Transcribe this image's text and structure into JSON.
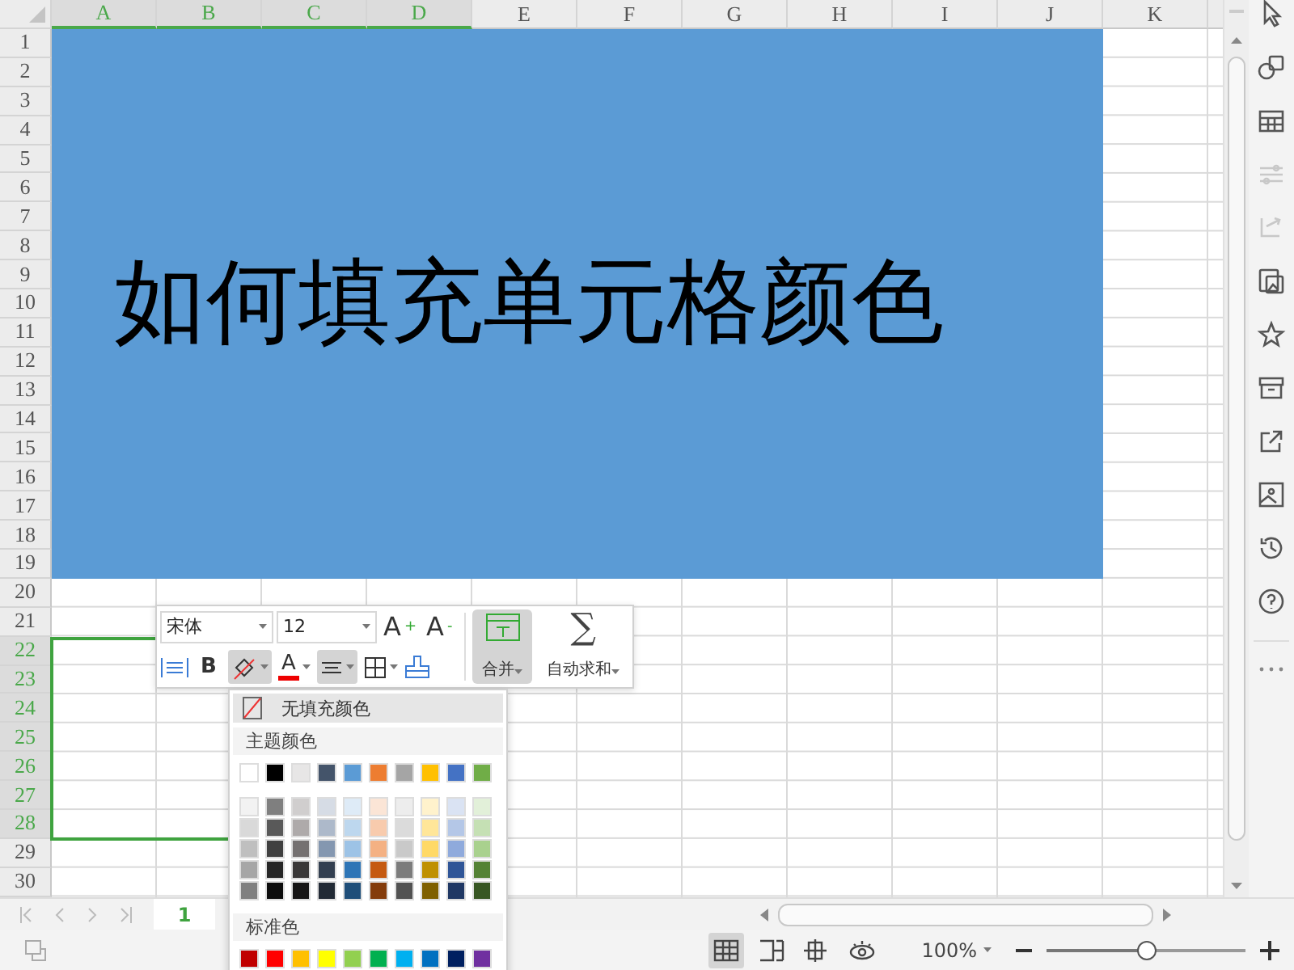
{
  "columns": [
    {
      "label": "A",
      "selected": true
    },
    {
      "label": "B",
      "selected": true
    },
    {
      "label": "C",
      "selected": true
    },
    {
      "label": "D",
      "selected": true
    },
    {
      "label": "E",
      "selected": false
    },
    {
      "label": "F",
      "selected": false
    },
    {
      "label": "G",
      "selected": false
    },
    {
      "label": "H",
      "selected": false
    },
    {
      "label": "I",
      "selected": false
    },
    {
      "label": "J",
      "selected": false
    },
    {
      "label": "K",
      "selected": false
    }
  ],
  "rows": [
    {
      "label": "1",
      "selected": false
    },
    {
      "label": "2",
      "selected": false
    },
    {
      "label": "3",
      "selected": false
    },
    {
      "label": "4",
      "selected": false
    },
    {
      "label": "5",
      "selected": false
    },
    {
      "label": "6",
      "selected": false
    },
    {
      "label": "7",
      "selected": false
    },
    {
      "label": "8",
      "selected": false
    },
    {
      "label": "9",
      "selected": false
    },
    {
      "label": "10",
      "selected": false
    },
    {
      "label": "11",
      "selected": false
    },
    {
      "label": "12",
      "selected": false
    },
    {
      "label": "13",
      "selected": false
    },
    {
      "label": "14",
      "selected": false
    },
    {
      "label": "15",
      "selected": false
    },
    {
      "label": "16",
      "selected": false
    },
    {
      "label": "17",
      "selected": false
    },
    {
      "label": "18",
      "selected": false
    },
    {
      "label": "19",
      "selected": false
    },
    {
      "label": "20",
      "selected": false
    },
    {
      "label": "21",
      "selected": false
    },
    {
      "label": "22",
      "selected": true
    },
    {
      "label": "23",
      "selected": true
    },
    {
      "label": "24",
      "selected": true
    },
    {
      "label": "25",
      "selected": true
    },
    {
      "label": "26",
      "selected": true
    },
    {
      "label": "27",
      "selected": true
    },
    {
      "label": "28",
      "selected": true
    },
    {
      "label": "29",
      "selected": false
    },
    {
      "label": "30",
      "selected": false
    }
  ],
  "merged_cell": {
    "text": "如何填充单元格颜色"
  },
  "mini_toolbar": {
    "font_name": "宋体",
    "font_size": "12",
    "grow_font_label": "A",
    "grow_font_sign": "+",
    "shrink_font_label": "A",
    "shrink_font_sign": "-",
    "bold_label": "B",
    "font_color_label": "A",
    "fill_pressed": true,
    "align_pressed": true,
    "merge_label": "合并",
    "merge_pressed": true,
    "autosum_symbol": "∑",
    "autosum_label": "自动求和"
  },
  "fill_menu": {
    "no_fill_label": "无填充颜色",
    "theme_label": "主题颜色",
    "theme_colors": [
      {
        "color": "#ffffff"
      },
      {
        "color": "#000000"
      },
      {
        "color": "#e7e6e6"
      },
      {
        "color": "#44546a"
      },
      {
        "color": "#5b9bd5"
      },
      {
        "color": "#ed7d31"
      },
      {
        "color": "#a5a5a5"
      },
      {
        "color": "#ffc000"
      },
      {
        "color": "#4472c4"
      },
      {
        "color": "#70ad47"
      }
    ],
    "shade_rows": [
      {
        "colors": [
          {
            "color": "#f2f2f2"
          },
          {
            "color": "#7f7f7f"
          },
          {
            "color": "#d0cece"
          },
          {
            "color": "#d6dce5"
          },
          {
            "color": "#deebf7"
          },
          {
            "color": "#fbe5d6"
          },
          {
            "color": "#ededed"
          },
          {
            "color": "#fff2cc"
          },
          {
            "color": "#dae3f3"
          },
          {
            "color": "#e2f0d9"
          }
        ]
      },
      {
        "colors": [
          {
            "color": "#d9d9d9"
          },
          {
            "color": "#595959"
          },
          {
            "color": "#aeaaaa"
          },
          {
            "color": "#adb9ca"
          },
          {
            "color": "#bdd7ee"
          },
          {
            "color": "#f8cbad"
          },
          {
            "color": "#dbdbdb"
          },
          {
            "color": "#ffe699"
          },
          {
            "color": "#b4c7e7"
          },
          {
            "color": "#c5e0b4"
          }
        ]
      },
      {
        "colors": [
          {
            "color": "#bfbfbf"
          },
          {
            "color": "#404040"
          },
          {
            "color": "#757171"
          },
          {
            "color": "#8497b0"
          },
          {
            "color": "#9dc3e6"
          },
          {
            "color": "#f4b183"
          },
          {
            "color": "#c9c9c9"
          },
          {
            "color": "#ffd966"
          },
          {
            "color": "#8faadc"
          },
          {
            "color": "#a9d18e"
          }
        ]
      },
      {
        "colors": [
          {
            "color": "#a6a6a6"
          },
          {
            "color": "#262626"
          },
          {
            "color": "#3a3838"
          },
          {
            "color": "#333f50"
          },
          {
            "color": "#2e75b6"
          },
          {
            "color": "#c55a11"
          },
          {
            "color": "#7c7c7c"
          },
          {
            "color": "#bf9000"
          },
          {
            "color": "#2f5597"
          },
          {
            "color": "#548235"
          }
        ]
      },
      {
        "colors": [
          {
            "color": "#808080"
          },
          {
            "color": "#0d0d0d"
          },
          {
            "color": "#171616"
          },
          {
            "color": "#222a35"
          },
          {
            "color": "#1f4e79"
          },
          {
            "color": "#843c0c"
          },
          {
            "color": "#525252"
          },
          {
            "color": "#7f6000"
          },
          {
            "color": "#203864"
          },
          {
            "color": "#385723"
          }
        ]
      }
    ],
    "standard_label": "标准色",
    "standard_colors": [
      {
        "color": "#c00000"
      },
      {
        "color": "#ff0000"
      },
      {
        "color": "#ffc000"
      },
      {
        "color": "#ffff00"
      },
      {
        "color": "#92d050"
      },
      {
        "color": "#00b050"
      },
      {
        "color": "#00b0f0"
      },
      {
        "color": "#0070c0"
      },
      {
        "color": "#002060"
      },
      {
        "color": "#7030a0"
      }
    ]
  },
  "sidebar": {
    "tools": [
      {
        "kind": "cursor",
        "disabled": false
      },
      {
        "kind": "shapes",
        "disabled": false
      },
      {
        "kind": "table",
        "disabled": false
      },
      {
        "kind": "sliders",
        "disabled": true
      },
      {
        "kind": "transfer",
        "disabled": true
      },
      {
        "kind": "gallery",
        "disabled": false
      },
      {
        "kind": "star",
        "disabled": false
      },
      {
        "kind": "archive",
        "disabled": false
      },
      {
        "kind": "share",
        "disabled": false
      },
      {
        "kind": "picture",
        "disabled": false
      },
      {
        "kind": "history",
        "disabled": false
      },
      {
        "kind": "help",
        "disabled": false
      }
    ]
  },
  "sheet_tabs": [
    {
      "label": "1",
      "selected": true
    }
  ],
  "status_bar": {
    "view_buttons": [
      {
        "kind": "normal",
        "selected": true
      },
      {
        "kind": "page-break",
        "selected": false
      },
      {
        "kind": "layout",
        "selected": false
      },
      {
        "kind": "eye",
        "selected": false
      }
    ],
    "zoom": "100%",
    "zoom_level": {
      "level": 0.5
    }
  }
}
